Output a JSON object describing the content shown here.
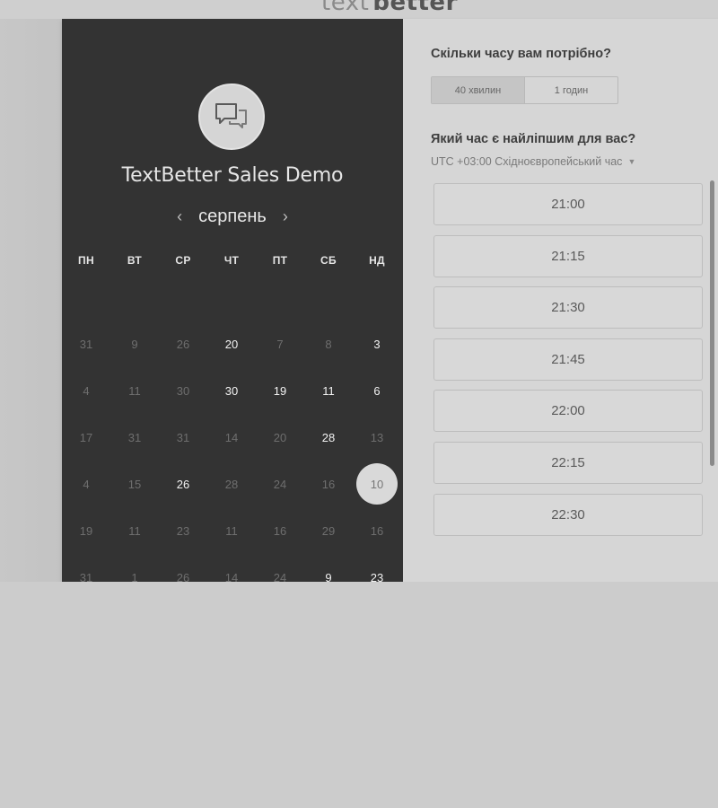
{
  "header": {
    "logo_light": "text",
    "logo_bold": "better"
  },
  "event": {
    "title": "TextBetter Sales Demo",
    "avatar_icon": "chat-bubbles-icon"
  },
  "calendar": {
    "month": "серпень",
    "prev_icon": "chevron-left-icon",
    "next_icon": "chevron-right-icon",
    "weekdays": [
      "ПН",
      "ВТ",
      "СР",
      "ЧТ",
      "ПТ",
      "СБ",
      "НД"
    ],
    "weeks": [
      [
        {
          "d": "31",
          "a": false
        },
        {
          "d": "9",
          "a": false
        },
        {
          "d": "26",
          "a": false
        },
        {
          "d": "20",
          "a": true
        },
        {
          "d": "7",
          "a": false
        },
        {
          "d": "8",
          "a": false
        },
        {
          "d": "3",
          "a": true
        }
      ],
      [
        {
          "d": "4",
          "a": false
        },
        {
          "d": "11",
          "a": false
        },
        {
          "d": "30",
          "a": false
        },
        {
          "d": "30",
          "a": true
        },
        {
          "d": "19",
          "a": true
        },
        {
          "d": "11",
          "a": true
        },
        {
          "d": "6",
          "a": true
        }
      ],
      [
        {
          "d": "17",
          "a": false
        },
        {
          "d": "31",
          "a": false
        },
        {
          "d": "31",
          "a": false
        },
        {
          "d": "14",
          "a": false
        },
        {
          "d": "20",
          "a": false
        },
        {
          "d": "28",
          "a": true
        },
        {
          "d": "13",
          "a": false
        }
      ],
      [
        {
          "d": "4",
          "a": false
        },
        {
          "d": "15",
          "a": false
        },
        {
          "d": "26",
          "a": true
        },
        {
          "d": "28",
          "a": false
        },
        {
          "d": "24",
          "a": false
        },
        {
          "d": "16",
          "a": false
        },
        {
          "d": "10",
          "a": true,
          "selected": true
        }
      ],
      [
        {
          "d": "19",
          "a": false
        },
        {
          "d": "11",
          "a": false
        },
        {
          "d": "23",
          "a": false
        },
        {
          "d": "11",
          "a": false
        },
        {
          "d": "16",
          "a": false
        },
        {
          "d": "29",
          "a": false
        },
        {
          "d": "16",
          "a": false
        }
      ],
      [
        {
          "d": "31",
          "a": false
        },
        {
          "d": "1",
          "a": false
        },
        {
          "d": "26",
          "a": false
        },
        {
          "d": "14",
          "a": false
        },
        {
          "d": "24",
          "a": false
        },
        {
          "d": "9",
          "a": true
        },
        {
          "d": "23",
          "a": true
        }
      ]
    ]
  },
  "booking": {
    "duration_question": "Скільки часу вам потрібно?",
    "durations": [
      {
        "label": "40 хвилин",
        "active": true
      },
      {
        "label": "1 годин",
        "active": false
      }
    ],
    "time_question": "Який час є найліпшим для вас?",
    "timezone": "UTC +03:00 Східноєвропейський час",
    "slots": [
      "21:00",
      "21:15",
      "21:30",
      "21:45",
      "22:00",
      "22:15",
      "22:30",
      ""
    ]
  }
}
